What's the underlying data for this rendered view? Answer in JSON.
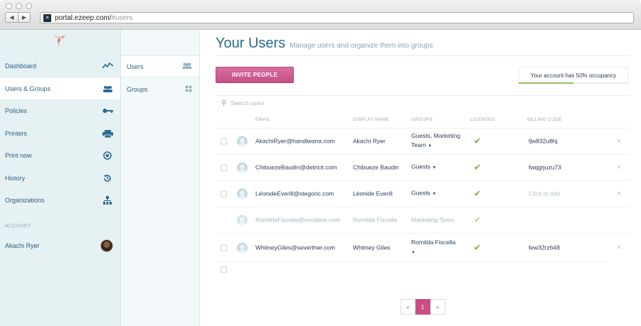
{
  "browser": {
    "url_host": "portal.ezeep.com/",
    "url_path": "#users"
  },
  "sidebar": {
    "items": [
      {
        "label": "Dashboard",
        "icon": "pulse-icon"
      },
      {
        "label": "Users & Groups",
        "icon": "users-icon"
      },
      {
        "label": "Policies",
        "icon": "key-icon"
      },
      {
        "label": "Printers",
        "icon": "printer-icon"
      },
      {
        "label": "Print now",
        "icon": "target-icon"
      },
      {
        "label": "History",
        "icon": "history-icon"
      },
      {
        "label": "Organizations",
        "icon": "organization-icon"
      }
    ],
    "account_label": "ACCOUNT",
    "account_name": "Akachi Ryer"
  },
  "subnav": {
    "items": [
      {
        "label": "Users",
        "icon": "users-icon"
      },
      {
        "label": "Groups",
        "icon": "groups-icon"
      }
    ]
  },
  "main": {
    "title": "Your Users",
    "subtitle": "Manage users and organize them into groups",
    "invite_label": "INVITE PEOPLE",
    "occupancy_text": "Your account has 50% occupancy",
    "occupancy_fraction": 0.5,
    "search_placeholder": "Search users",
    "columns": [
      "EMAIL",
      "DISPLAY NAME",
      "GROUPS",
      "LICENSED",
      "BILLING CODE"
    ],
    "rows": [
      {
        "email": "AkachiRyer@handlwana.com",
        "name": "Akachi Ryer",
        "groups_line1": "Guests, Marketing",
        "groups_line2": "Team",
        "licensed": "✔",
        "billing": "fjw832u8hj",
        "delete": "×"
      },
      {
        "email": "ChibuezeBaudin@detricit.com",
        "name": "Chibueze Baudin",
        "groups_line1": "Guests",
        "groups_line2": "",
        "licensed": "✔",
        "billing": "fwqgrjuzu73",
        "delete": "×"
      },
      {
        "email": "LéonideEverill@stegoric.com",
        "name": "Léonide Everill",
        "groups_line1": "Guests",
        "groups_line2": "",
        "licensed": "✔",
        "billing": "Click to add",
        "delete": "×"
      },
      {
        "email": "RomildaFiscella@noodleia.com",
        "name": "Romilda Fiscella",
        "groups_line1": "Marketing Team",
        "groups_line2": "",
        "licensed": "✔",
        "billing": "",
        "delete": ""
      },
      {
        "email": "WhitneyGiles@severther.com",
        "name": "Whitney Giles",
        "groups_line1": "Romilda Fiscella",
        "groups_line2": "",
        "licensed": "✔",
        "billing": "few32rz648",
        "delete": "×"
      }
    ],
    "pagination": {
      "prev": "«",
      "current": "1",
      "next": "»"
    }
  }
}
